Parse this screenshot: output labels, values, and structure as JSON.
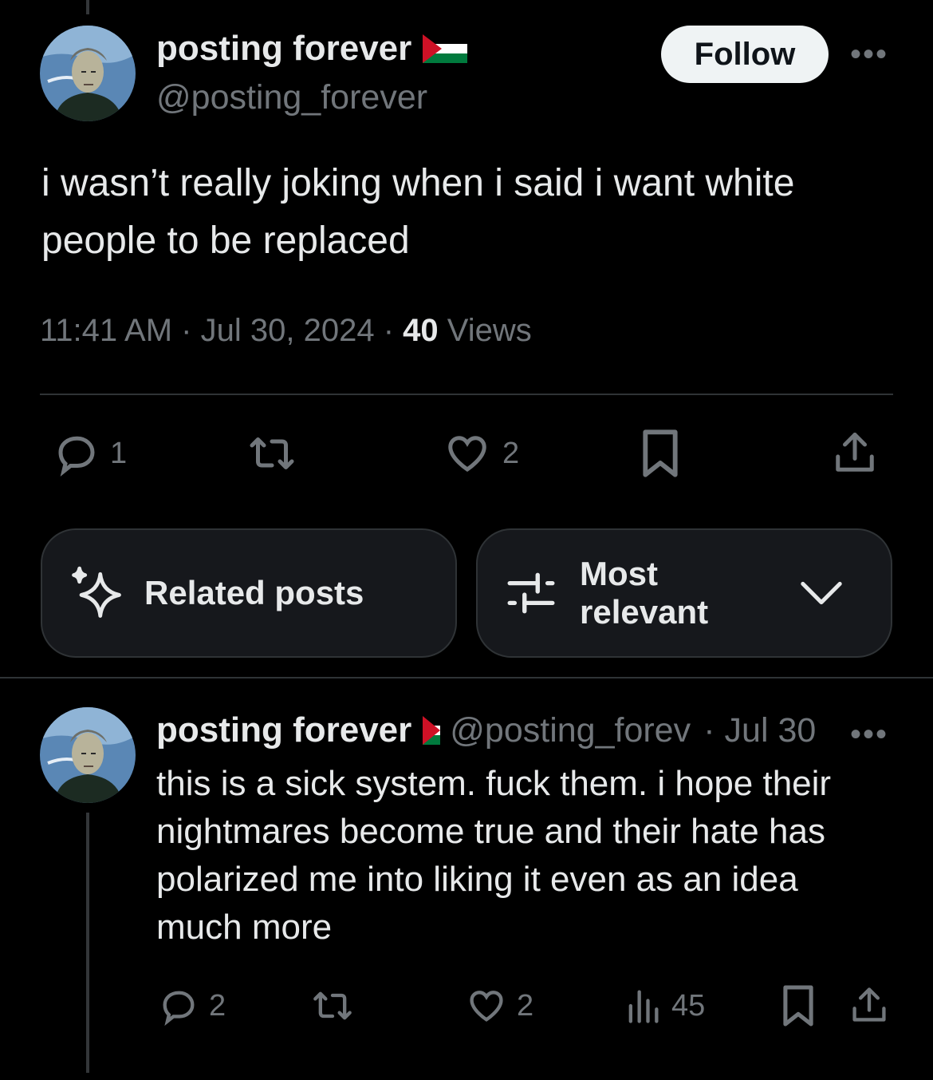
{
  "main_tweet": {
    "author_name": "posting forever",
    "author_handle": "@posting_forever",
    "follow_label": "Follow",
    "more_label": "•••",
    "text": "i wasn’t really joking when i said i want white people to be replaced",
    "time": "11:41 AM",
    "date": "Jul 30, 2024",
    "views_count": "40",
    "views_label": "Views",
    "separator": "·",
    "reply_count": "1",
    "like_count": "2"
  },
  "filters": {
    "related_label": "Related posts",
    "sort_label_line1": "Most",
    "sort_label_line2": "relevant"
  },
  "reply": {
    "author_name": "posting forever",
    "author_handle": "@posting_forev",
    "date": "· Jul 30",
    "more_label": "•••",
    "text": "this is a sick system. fuck them. i hope their nightmares become true and their hate has polarized me into liking it even as an idea much more",
    "reply_count": "2",
    "like_count": "2",
    "views_count": "45"
  },
  "colors": {
    "background": "#000000",
    "text": "#e7e9ea",
    "secondary": "#71767b",
    "divider": "#2f3336",
    "flag_red": "#ce1126",
    "flag_green": "#007a3d"
  }
}
